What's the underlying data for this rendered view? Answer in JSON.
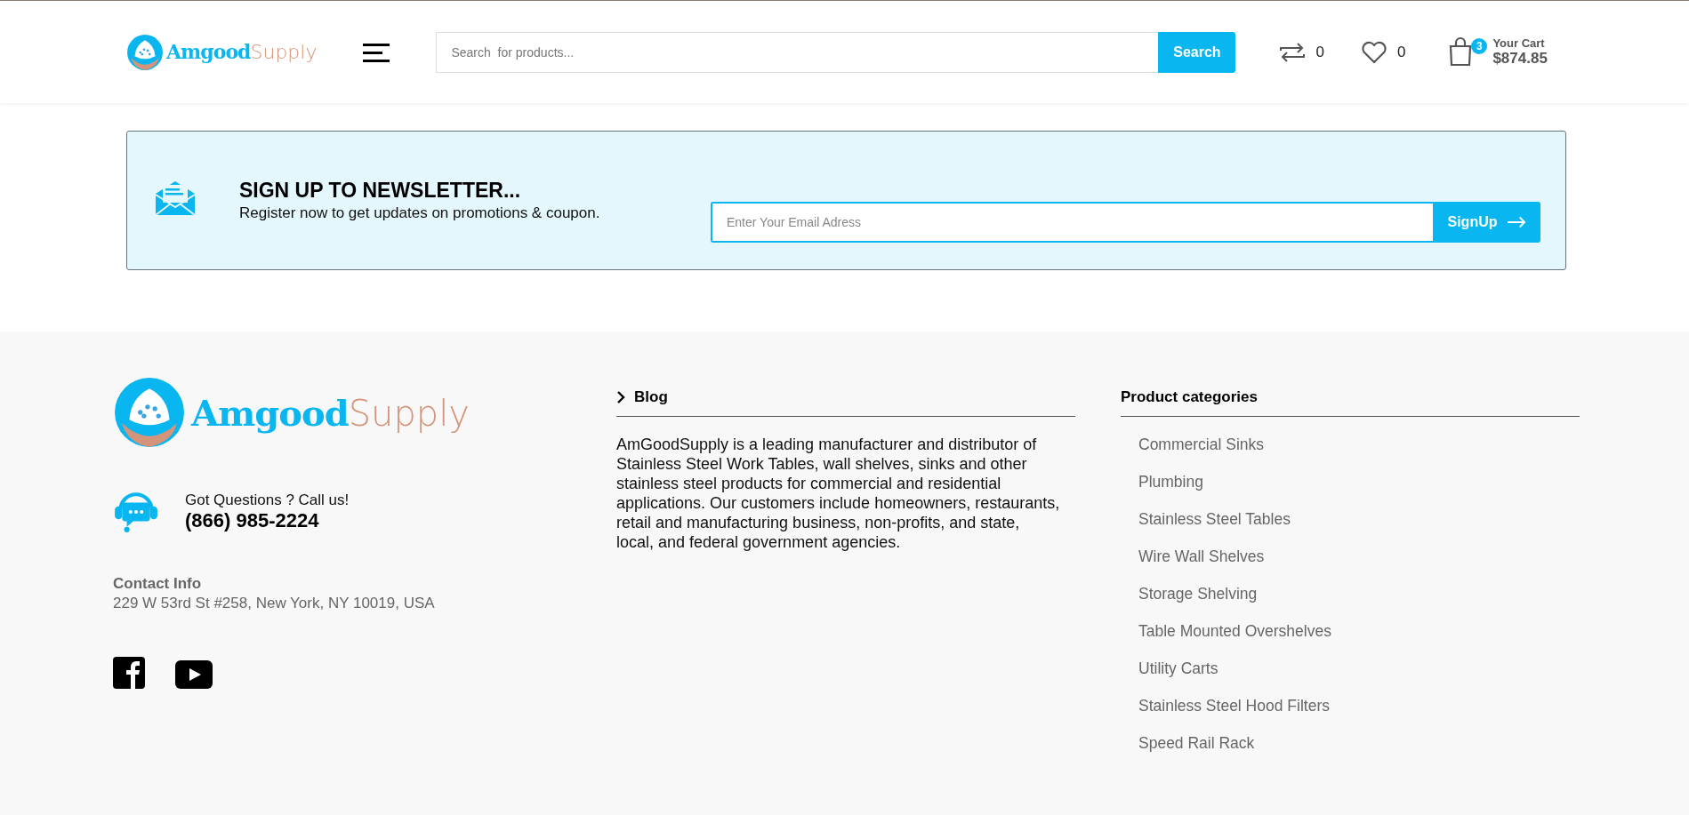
{
  "header": {
    "logo": {
      "brand": "Amgood",
      "suffix": "Supply"
    },
    "search": {
      "placeholder": "Search  for products...",
      "button": "Search"
    },
    "compare_count": "0",
    "wishlist_count": "0",
    "cart": {
      "badge": "3",
      "label": "Your Cart",
      "total": "$874.85"
    }
  },
  "newsletter": {
    "title": "SIGN UP TO NEWSLETTER...",
    "subtitle": "Register now to get updates on promotions & coupon.",
    "email_placeholder": "Enter Your Email Adress",
    "button": "SignUp"
  },
  "footer": {
    "logo": {
      "brand": "Amgood",
      "suffix": "Supply"
    },
    "call_prompt": "Got Questions ? Call us!",
    "phone": "(866) 985-2224",
    "contact_title": "Contact Info",
    "address": "229 W 53rd St #258, New York, NY 10019, USA",
    "blog": {
      "title": "Blog",
      "text": "AmGoodSupply is a leading manufacturer and distributor of Stainless Steel Work Tables, wall shelves, sinks and other stainless steel products for commercial and residential applications. Our customers include homeowners, restaurants, retail and manufacturing business, non-profits, and state, local, and federal government agencies."
    },
    "categories": {
      "title": "Product categories",
      "items": [
        "Commercial Sinks",
        "Plumbing",
        "Stainless Steel Tables",
        "Wire Wall Shelves",
        "Storage Shelving",
        "Table Mounted Overshelves",
        "Utility Carts",
        "Stainless Steel Hood Filters",
        "Speed Rail Rack"
      ]
    }
  }
}
